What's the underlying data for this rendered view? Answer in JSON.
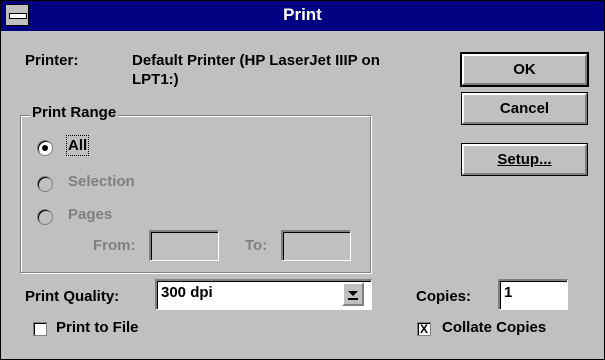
{
  "window": {
    "title": "Print"
  },
  "printer": {
    "label": "Printer:",
    "name_line1": "Default Printer (HP LaserJet IIIP on",
    "name_line2": "LPT1:)"
  },
  "buttons": {
    "ok": "OK",
    "cancel": "Cancel",
    "setup": "Setup..."
  },
  "print_range": {
    "label": "Print Range",
    "selected": "All",
    "options": [
      {
        "label": "All",
        "enabled": true
      },
      {
        "label": "Selection",
        "enabled": false
      },
      {
        "label": "Pages",
        "enabled": false
      }
    ],
    "from_label": "From:",
    "from_value": "",
    "to_label": "To:",
    "to_value": ""
  },
  "print_quality": {
    "label": "Print Quality:",
    "value": "300 dpi"
  },
  "copies": {
    "label": "Copies:",
    "value": "1"
  },
  "print_to_file": {
    "label": "Print to File",
    "checked": false
  },
  "collate": {
    "label": "Collate Copies",
    "checked": true,
    "mark": "X"
  },
  "icons": {
    "system_menu": "system-menu-icon",
    "combo_arrow": "combo-down-arrow-icon"
  },
  "colors": {
    "title_bar": "#000080",
    "dialog_bg": "#c0c0c0",
    "disabled_text": "#808080"
  }
}
